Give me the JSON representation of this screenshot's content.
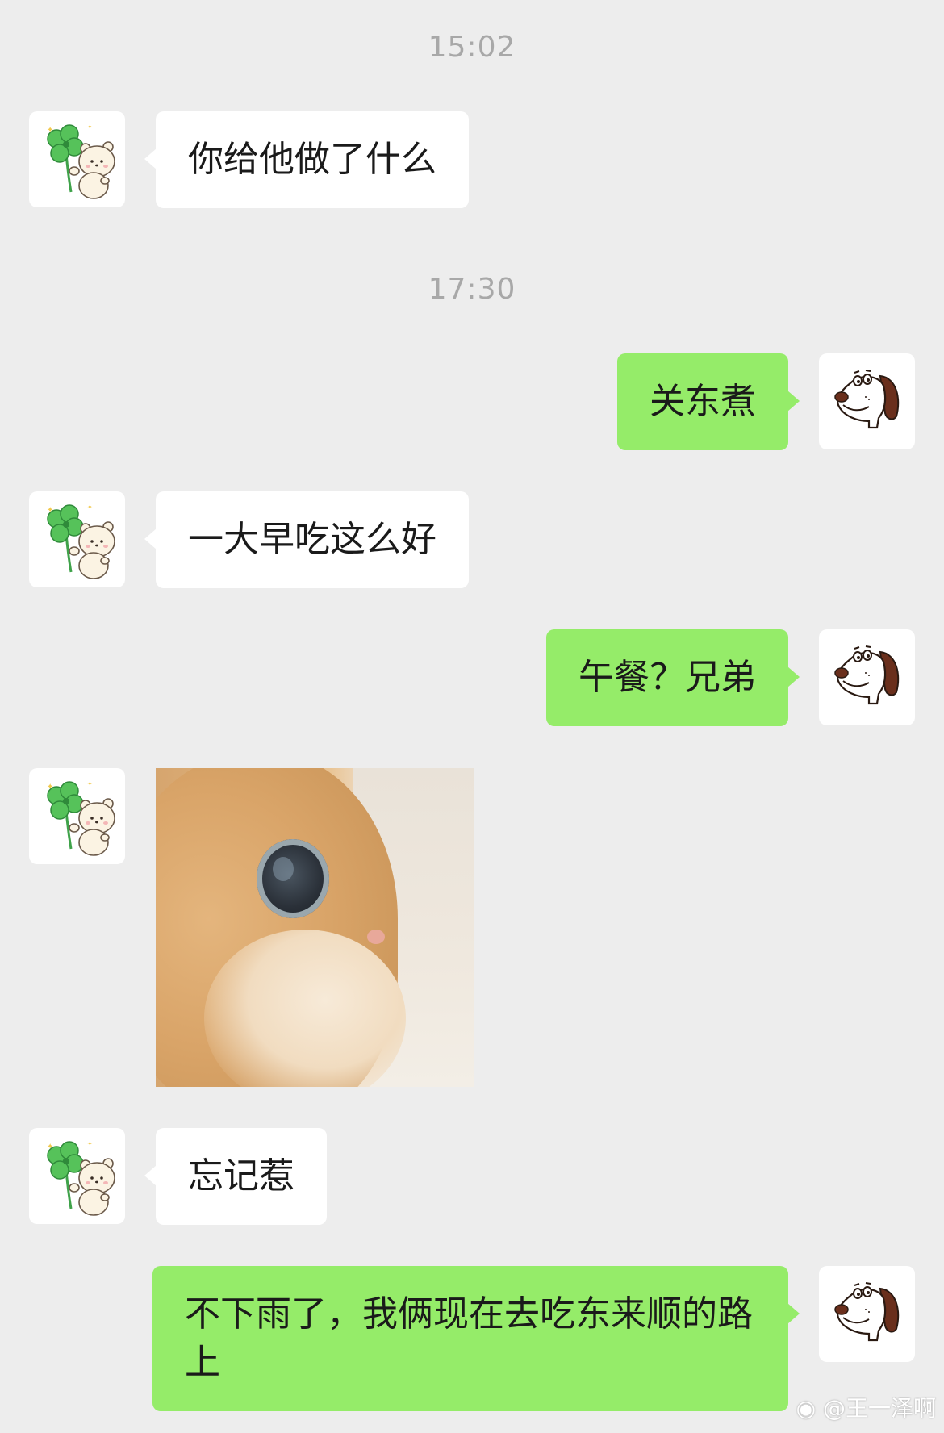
{
  "timestamps": [
    "15:02",
    "17:30"
  ],
  "messages": [
    {
      "sender": "friend",
      "type": "text",
      "text": "你给他做了什么"
    },
    {
      "sender": "me",
      "type": "text",
      "text": "关东煮"
    },
    {
      "sender": "friend",
      "type": "text",
      "text": "一大早吃这么好"
    },
    {
      "sender": "me",
      "type": "text",
      "text": "午餐？兄弟"
    },
    {
      "sender": "friend",
      "type": "image",
      "image": "cat-closeup-photo"
    },
    {
      "sender": "friend",
      "type": "text",
      "text": "忘记惹"
    },
    {
      "sender": "me",
      "type": "text",
      "text": "不下雨了，我俩现在去吃东来顺的路上"
    }
  ],
  "avatars": {
    "friend": "clover-bear-avatar",
    "me": "cartoon-dog-avatar"
  },
  "colors": {
    "background": "#ededed",
    "incoming_bubble": "#ffffff",
    "outgoing_bubble": "#95ec69",
    "timestamp": "#a8a8a8"
  },
  "watermark": {
    "icon": "weibo-icon",
    "text": "@王一泽啊"
  }
}
